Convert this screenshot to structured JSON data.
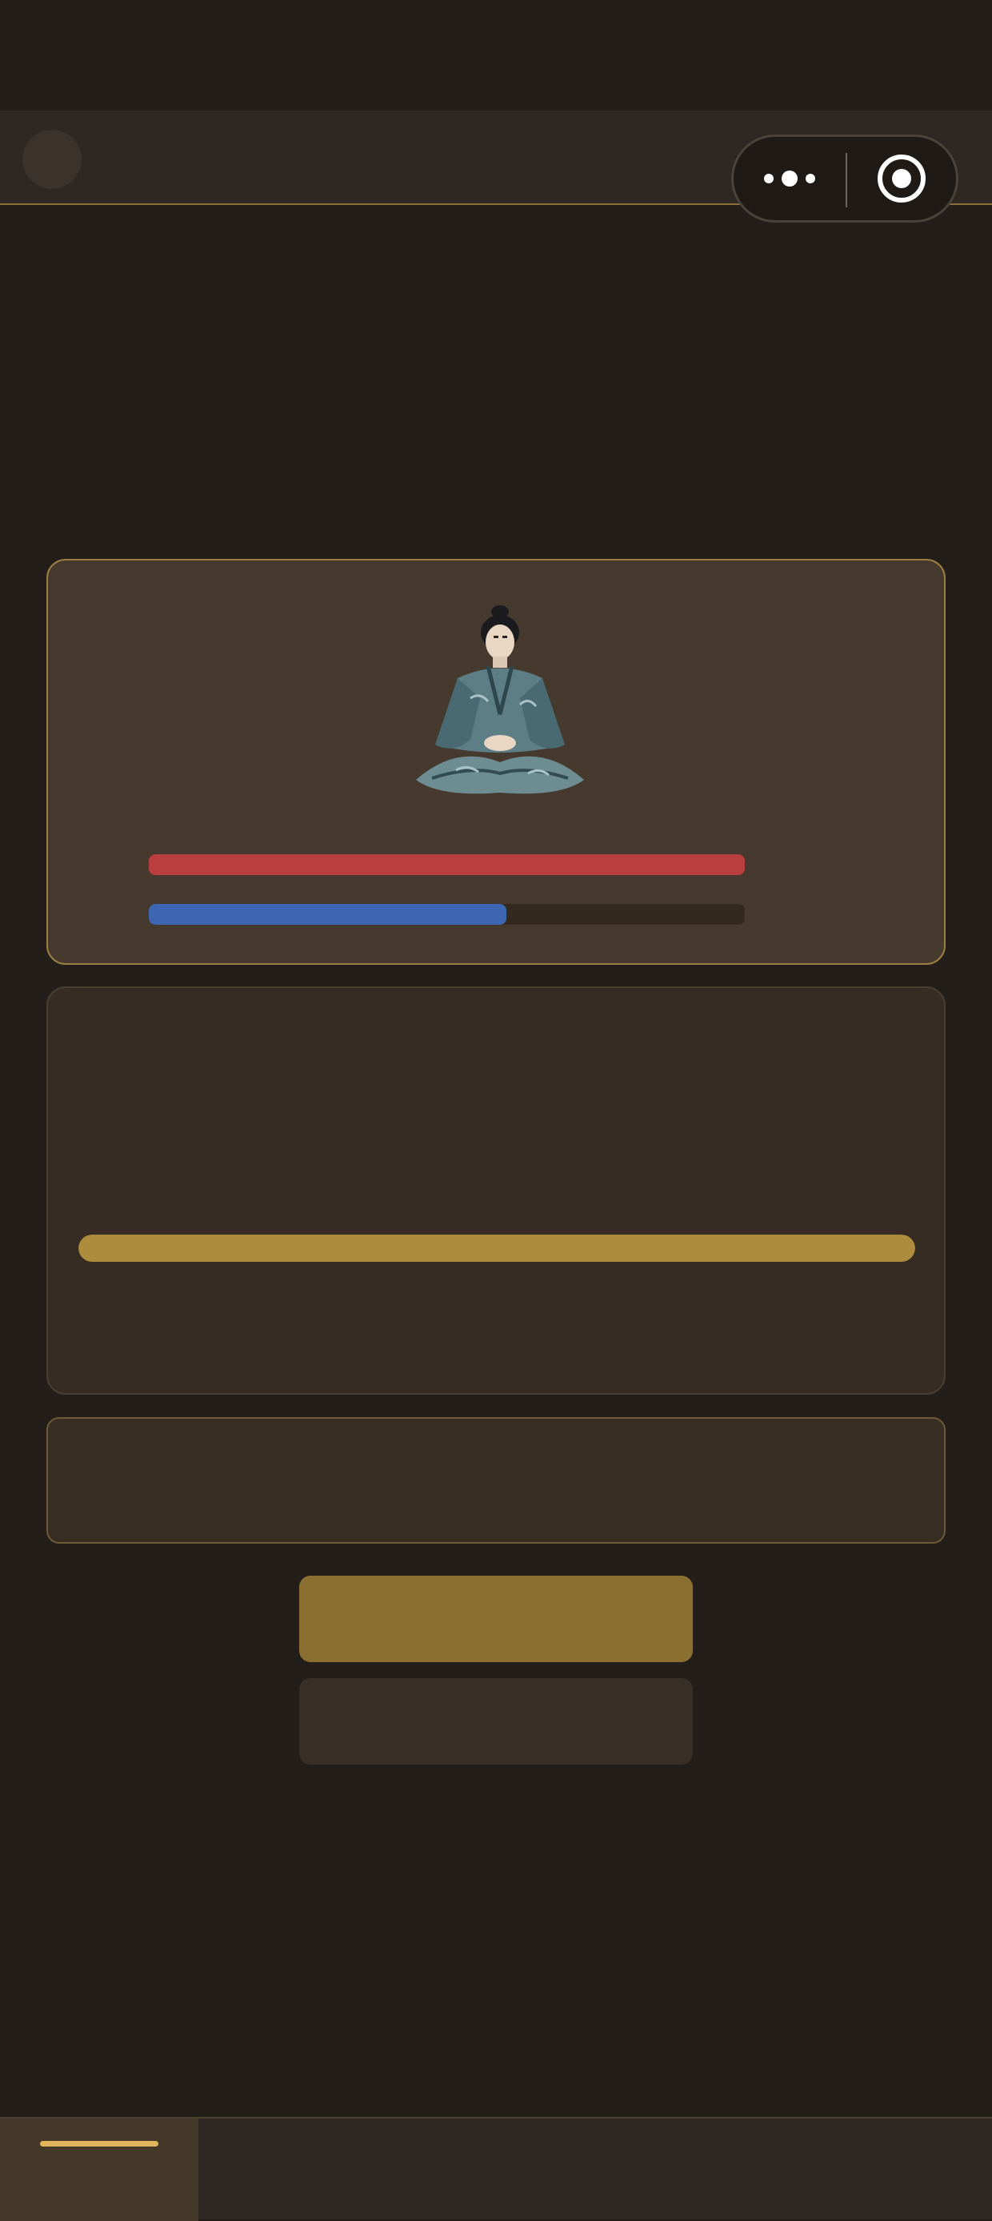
{
  "theme": {
    "background": "#231e19",
    "accent": "#ad8c3e",
    "hp_color": "#bb3f3f",
    "mp_color": "#3e66b3"
  },
  "nav": {
    "back_icon": "circle-back-icon",
    "capsule": {
      "more_icon": "more-dots-icon",
      "close_icon": "target-close-icon"
    }
  },
  "character": {
    "portrait_icon": "meditating-swordsman-figure",
    "hp_fraction": 1.0,
    "mp_fraction": 0.6
  },
  "cultivation": {
    "progress_fraction": 1.0
  },
  "log": {
    "lines": []
  },
  "actions": {
    "primary_label": "",
    "secondary_label": ""
  },
  "tabbar": {
    "active_index": 0,
    "tabs": [
      {
        "label": ""
      },
      {
        "label": ""
      },
      {
        "label": ""
      },
      {
        "label": ""
      },
      {
        "label": ""
      }
    ]
  }
}
